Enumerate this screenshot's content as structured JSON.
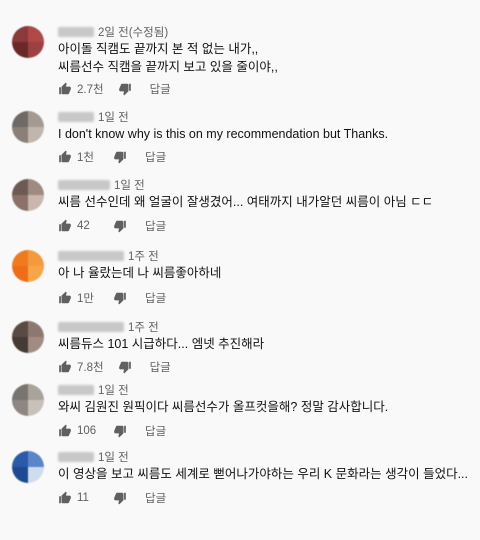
{
  "comments": [
    {
      "time": "2일 전(수정됨)",
      "lines": [
        "아이돌 직캠도 끝까지 본 적 없는 내가,,",
        "씨름선수 직캠을 끝까지 보고 있을 줄이야,,"
      ],
      "likes": "2.7천",
      "reply": "답글",
      "avatar": [
        "#8a3a3a",
        "#b04848",
        "#6a2828",
        "#9c4040"
      ]
    },
    {
      "time": "1일 전",
      "lines": [
        "I don't know why is this on my recommendation but Thanks."
      ],
      "likes": "1천",
      "reply": "답글",
      "avatar": [
        "#6f6a66",
        "#a59a92",
        "#8a8078",
        "#c0b6ae"
      ]
    },
    {
      "time": "1일 전",
      "lines": [
        "씨름 선수인데 왜 얼굴이 잘생겼어... 여태까지 내가알던 씨름이 아님 ㄷㄷ"
      ],
      "likes": "42",
      "reply": "답글",
      "avatar": [
        "#6e5a54",
        "#a08a80",
        "#8b7168",
        "#c9b6ac"
      ]
    },
    {
      "time": "1주 전",
      "lines": [
        "아 나 율랐는데 나 씨름좋아하네"
      ],
      "likes": "1만",
      "reply": "답글",
      "avatar": [
        "#f07a20",
        "#f49a3c",
        "#ee6d1a",
        "#f6a54a"
      ]
    },
    {
      "time": "1주 전",
      "lines": [
        "씨름듀스 101 시급하다... 엠넷 추진해라"
      ],
      "likes": "7.8천",
      "reply": "답글",
      "avatar": [
        "#5a4a44",
        "#8c7870",
        "#463a36",
        "#a08c82"
      ]
    },
    {
      "time": "1일 전",
      "lines": [
        "와씨 김원진 원픽이다 씨름선수가 올프컷을해? 정말 감사합니다."
      ],
      "likes": "106",
      "reply": "답글",
      "avatar": [
        "#7a7470",
        "#aaa39c",
        "#8e8680",
        "#c8c1ba"
      ]
    },
    {
      "time": "1일 전",
      "lines": [
        "이 영상을 보고 씨름도 세계로 뻗어나가야하는 우리 K 문화라는 생각이 들었다..."
      ],
      "likes": "11",
      "reply": "답글",
      "avatar": [
        "#2a5aa8",
        "#5a86c8",
        "#1e4a90",
        "#d0dcec"
      ]
    }
  ]
}
